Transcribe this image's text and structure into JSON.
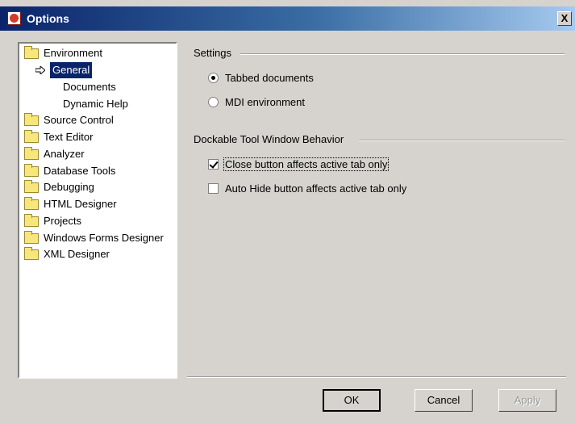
{
  "window": {
    "title": "Options",
    "close_glyph": "X"
  },
  "tree": {
    "items": [
      {
        "label": "Environment",
        "icon": "folder-open-icon"
      },
      {
        "label": "General",
        "icon": "arrow-right-icon",
        "selected": true
      },
      {
        "label": "Documents"
      },
      {
        "label": "Dynamic Help"
      },
      {
        "label": "Source Control",
        "icon": "folder-icon"
      },
      {
        "label": "Text Editor",
        "icon": "folder-icon"
      },
      {
        "label": "Analyzer",
        "icon": "folder-icon"
      },
      {
        "label": "Database Tools",
        "icon": "folder-icon"
      },
      {
        "label": "Debugging",
        "icon": "folder-icon"
      },
      {
        "label": "HTML Designer",
        "icon": "folder-icon"
      },
      {
        "label": "Projects",
        "icon": "folder-icon"
      },
      {
        "label": "Windows Forms Designer",
        "icon": "folder-icon"
      },
      {
        "label": "XML Designer",
        "icon": "folder-icon"
      }
    ]
  },
  "settings": {
    "group_label": "Settings",
    "options": [
      {
        "label": "Tabbed documents",
        "checked": true
      },
      {
        "label": "MDI environment",
        "checked": false
      }
    ]
  },
  "dockable": {
    "group_label": "Dockable Tool Window Behavior",
    "options": [
      {
        "label": "Close button affects active tab only",
        "checked": true
      },
      {
        "label": "Auto Hide button affects active tab only",
        "checked": false
      }
    ]
  },
  "buttons": {
    "ok": "OK",
    "cancel": "Cancel",
    "apply": "Apply"
  }
}
